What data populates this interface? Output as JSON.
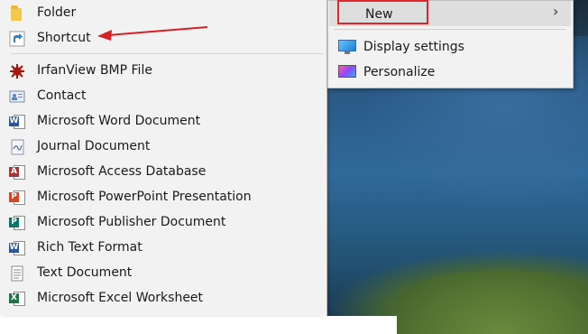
{
  "submenu": {
    "items": [
      {
        "label": "Folder",
        "icon": "folder-icon"
      },
      {
        "label": "Shortcut",
        "icon": "shortcut-icon"
      },
      {
        "label": "IrfanView BMP File",
        "icon": "irfanview-icon"
      },
      {
        "label": "Contact",
        "icon": "contact-icon"
      },
      {
        "label": "Microsoft Word Document",
        "icon": "word-icon"
      },
      {
        "label": "Journal Document",
        "icon": "journal-icon"
      },
      {
        "label": "Microsoft Access Database",
        "icon": "access-icon"
      },
      {
        "label": "Microsoft PowerPoint Presentation",
        "icon": "powerpoint-icon"
      },
      {
        "label": "Microsoft Publisher Document",
        "icon": "publisher-icon"
      },
      {
        "label": "Rich Text Format",
        "icon": "rtf-icon"
      },
      {
        "label": "Text Document",
        "icon": "text-document-icon"
      },
      {
        "label": "Microsoft Excel Worksheet",
        "icon": "excel-icon"
      }
    ]
  },
  "context_menu": {
    "new_label": "New",
    "display_settings_label": "Display settings",
    "personalize_label": "Personalize"
  },
  "colors": {
    "highlight_box": "#e0262a",
    "arrow": "#d61f26",
    "word": "#2b579a",
    "access": "#a4373a",
    "powerpoint": "#d24726",
    "publisher": "#077568",
    "excel": "#217346"
  }
}
